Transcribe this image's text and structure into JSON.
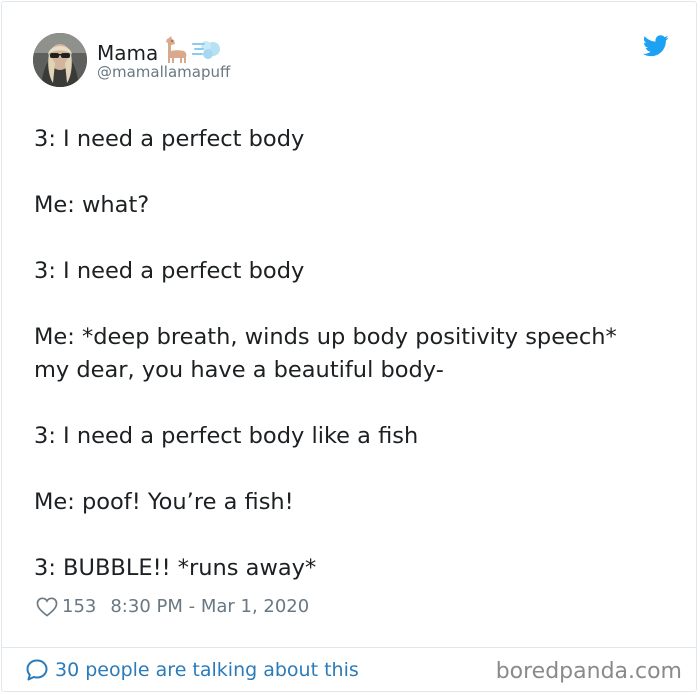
{
  "author": {
    "display_name": "Mama",
    "handle": "@mamallamapuff"
  },
  "icons": {
    "emoji_1": "llama-emoji-icon",
    "emoji_2": "dash-emoji-icon",
    "brand": "twitter-bird-icon",
    "like": "heart-icon",
    "reply": "speech-bubble-icon"
  },
  "tweet": {
    "lines": [
      "3: I need a perfect body",
      "",
      "Me: what?",
      "",
      "3: I need a perfect body",
      "",
      "Me: *deep breath, winds up body positivity speech*",
      "my dear, you have a beautiful body-",
      "",
      "3: I need a perfect body like a fish",
      "",
      "Me: poof! You’re a fish!",
      "",
      "3: BUBBLE!! *runs away*"
    ]
  },
  "meta": {
    "likes": "153",
    "timestamp": "8:30 PM - Mar 1, 2020"
  },
  "footer": {
    "talking": "30 people are talking about this",
    "watermark": "boredpanda.com"
  },
  "colors": {
    "link_blue": "#2b7bb9",
    "twitter_blue": "#1da1f2",
    "muted": "#697882",
    "text": "#1c2022",
    "border": "#e1e8ed"
  }
}
